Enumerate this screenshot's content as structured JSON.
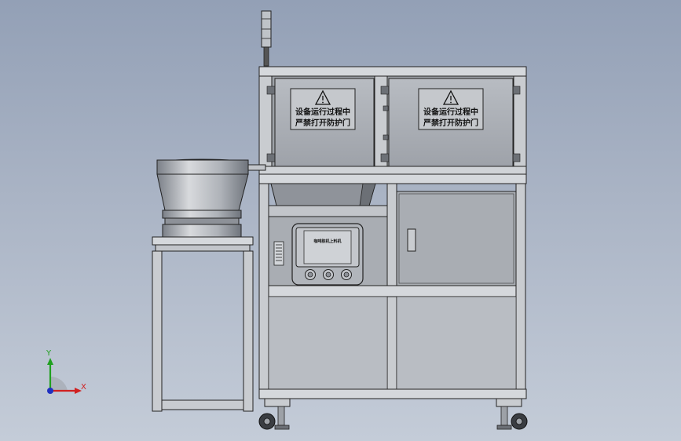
{
  "panels": {
    "left_warning": {
      "line1": "设备运行过程中",
      "line2": "严禁打开防护门"
    },
    "right_warning": {
      "line1": "设备运行过程中",
      "line2": "严禁打开防护门"
    }
  },
  "hmi": {
    "title": "咖啡胶机上料机"
  },
  "triad": {
    "x_label": "X",
    "y_label": "Y"
  },
  "colors": {
    "background_top": "#93a0b6",
    "background_bottom": "#c4ccd8",
    "frame": "#c9ccd0",
    "panel": "#a9adb3",
    "outline": "#222222",
    "axis_x": "#d02020",
    "axis_y": "#20a020",
    "axis_z": "#2030c0"
  }
}
